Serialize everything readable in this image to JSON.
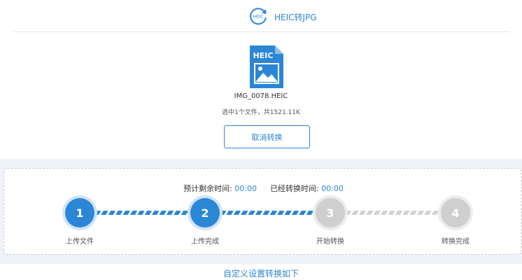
{
  "header": {
    "title": "HEIC转JPG",
    "logo_text": "HEIC"
  },
  "file": {
    "icon_label": "HEIC",
    "name": "IMG_0078.HEIC",
    "info": "选中1个文件，共1521.11K"
  },
  "actions": {
    "cancel_label": "取消转换"
  },
  "progress": {
    "remaining_label": "预计剩余时间:",
    "remaining_value": "00:00",
    "elapsed_label": "已经转换时间:",
    "elapsed_value": "00:00",
    "steps": [
      {
        "number": "1",
        "label": "上传文件",
        "state": "done"
      },
      {
        "number": "2",
        "label": "上传完成",
        "state": "done"
      },
      {
        "number": "3",
        "label": "开始转换",
        "state": "todo"
      },
      {
        "number": "4",
        "label": "转换完成",
        "state": "todo"
      }
    ]
  },
  "footer": {
    "custom_label": "自定义设置转换如下"
  },
  "colors": {
    "accent": "#2b86d6",
    "inactive": "#cfcfcf",
    "band": "#eef3fa"
  }
}
